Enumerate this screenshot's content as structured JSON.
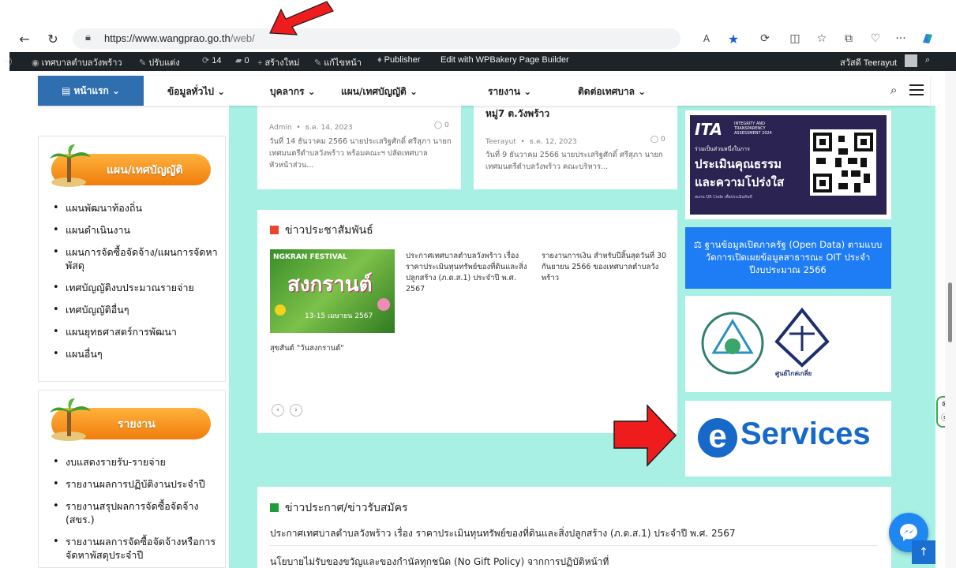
{
  "browser": {
    "url_host": "https://www.wangprao.go.th",
    "url_path": "/web/",
    "back_icon": "arrow-left-icon",
    "reload_icon": "reload-icon",
    "read_aloud_label": "A",
    "more_label": "···"
  },
  "adminbar": {
    "site_name": "เทศบาลตำบลวังพร้าว",
    "customize": "ปรับแต่ง",
    "updates_count": "14",
    "comments_count": "0",
    "new_label": "สร้างใหม่",
    "edit_label": "แก้ไขหน้า",
    "publisher_label": "Publisher",
    "wpbakery_label": "Edit with WPBakery Page Builder",
    "greeting": "สวัสดี Teerayut"
  },
  "nav": {
    "home": "หน้าแรก",
    "items": [
      "ข้อมูลทั่วไป",
      "บุคลากร",
      "แผน/เทศบัญญัติ",
      "รายงาน",
      "ติดต่อเทศบาล"
    ]
  },
  "sidebar": {
    "plans": {
      "title": "แผน/เทศบัญญัติ",
      "items": [
        "แผนพัฒนาท้องถิ่น",
        "แผนดำเนินงาน",
        "แผนการจัดซื้อจัดจ้าง/แผนการจัดหาพัสดุ",
        "เทศบัญญัติงบประมาณรายจ่าย",
        "เทศบัญญัติอื่นๆ",
        "แผนยุทธศาสตร์การพัฒนา",
        "แผนอื่นๆ"
      ]
    },
    "reports": {
      "title": "รายงาน",
      "items": [
        "งบแสดงรายรับ-รายจ่าย",
        "รายงานผลการปฏิบัติงานประจำปี",
        "รายงานสรุปผลการจัดซื้อจัดจ้าง (สขร.)",
        "รายงานผลการจัดซื้อจัดจ้างหรือการจัดหาพัสดุประจำปี"
      ]
    }
  },
  "news_top": [
    {
      "title_tail": "หมู่7 ต.วังพร้าว",
      "author": "Admin",
      "date": "ธ.ค. 14, 2023",
      "comments": "0",
      "excerpt": "วันที่ 14 ธันวาคม 2566 นายประเสริฐศักดิ์ ศรีสุภา นายกเทศมนตรีตำบลวังพร้าว พร้อมคณะฯ ปลัดเทศบาล หัวหน้าส่วน..."
    },
    {
      "title_tail": "หมู่7 ต.วังพร้าว",
      "author": "Teerayut",
      "date": "ธ.ค. 12, 2023",
      "comments": "0",
      "excerpt": "วันที่ 9 ธันวาคม 2566 นายประเสริฐศักดิ์ ศรีสุภา นายกเทศมนตรีตำบลวังพร้าว คณะบริหาร..."
    }
  ],
  "pr": {
    "title": "ข่าวประชาสัมพันธ์",
    "image_caption": "สุขสันต์ \"วันสงกรานต์\"",
    "festival_top": "NGKRAN FESTIVAL",
    "festival_main": "สงกรานต์",
    "festival_date": "13-15 เมษายน 2567",
    "item2": "ประกาศเทศบาลตำบลวังพร้าว เรื่อง ราคาประเมินทุนทรัพย์ของที่ดินและสิ่งปลูกสร้าง (ภ.ด.ส.1) ประจำปี พ.ศ. 2567",
    "item3": "รายงานการเงิน สำหรับปีสิ้นสุดวันที่ 30 กันยายน 2566 ของเทศบาลตำบลวังพร้าว",
    "prev_icon": "chevron-left-icon",
    "next_icon": "chevron-right-icon",
    "accent": "#e8452c"
  },
  "announce": {
    "title": "ข่าวประกาศ/ข่าวรับสมัคร",
    "accent": "#1f9d3a",
    "items": [
      "ประกาศเทศบาลตำบลวังพร้าว เรื่อง ราคาประเมินทุนทรัพย์ของที่ดินและสิ่งปลูกสร้าง (ภ.ด.ส.1) ประจำปี พ.ศ. 2567",
      "นโยบายไม่รับของขวัญและของกำนัลทุกชนิด (No Gift Policy) จากการปฏิบัติหน้าที่"
    ]
  },
  "right": {
    "ita_logo": "ITA",
    "ita_sub": "INTEGRITY AND TRANSPARENCY ASSESSMENT 2024",
    "ita_line1": "ร่วมเป็นส่วนหนึ่งในการ",
    "ita_line2": "ประเมินคุณธรรม",
    "ita_line3": "และความโปร่งใส",
    "ita_line4": "สแกน QR Code เพื่อประเมินทันที",
    "opendata": "ฐานข้อมูลเปิดภาครัฐ (Open Data) ตามแบบวัดการเปิดเผยข้อมูลสาธารณะ OIT ประจำปีงบประมาณ 2566",
    "justice_caption": "ศูนย์ไกล่เกลี่ย",
    "eservices_word": "Services",
    "eservices_e": "e"
  }
}
